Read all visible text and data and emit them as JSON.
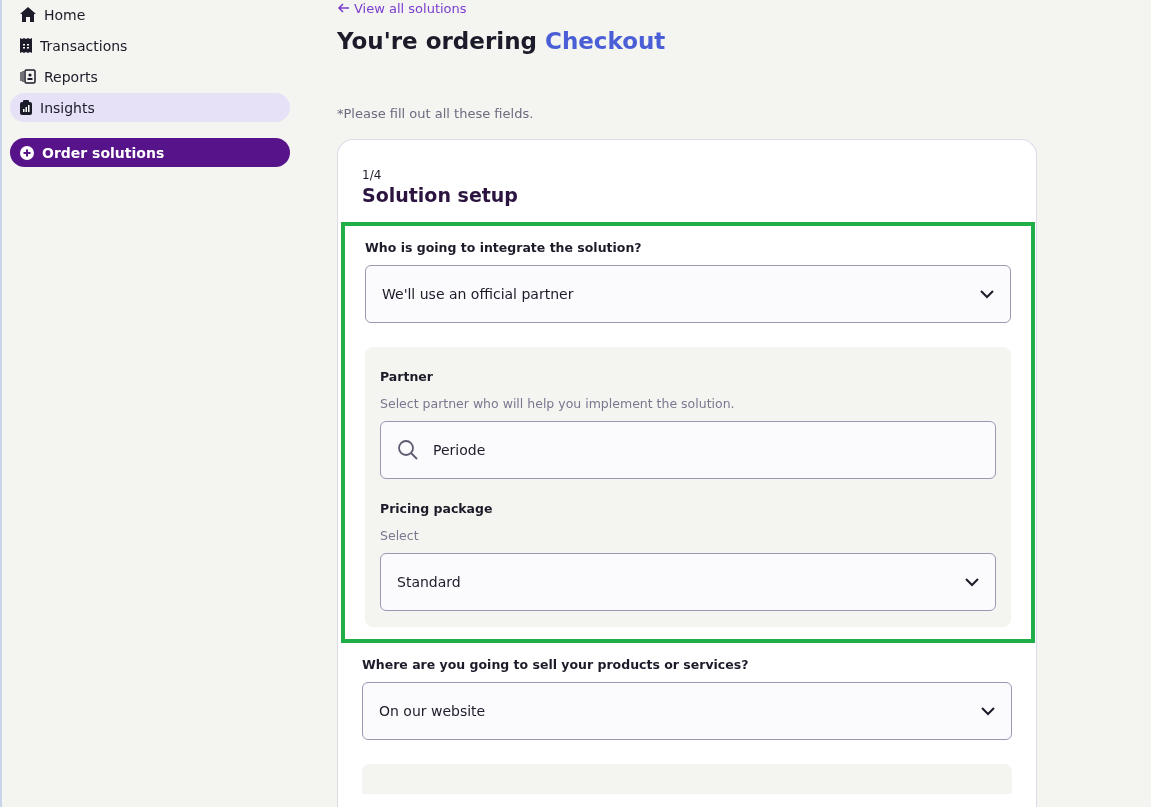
{
  "sidebar": {
    "items": [
      {
        "label": "Home",
        "selected": false
      },
      {
        "label": "Transactions",
        "selected": false
      },
      {
        "label": "Reports",
        "selected": false
      },
      {
        "label": "Insights",
        "selected": true
      }
    ],
    "action_button": {
      "label": "Order solutions"
    }
  },
  "back_link": "View all solutions",
  "title": {
    "text": "You're ordering",
    "product": "Checkout"
  },
  "note": "*Please fill out all these fields.",
  "card": {
    "step": "1/4",
    "heading": "Solution setup",
    "highlighted": true,
    "integrator": {
      "label": "Who is going to integrate the solution?",
      "value": "We'll use an official partner"
    },
    "partner_panel": {
      "partner_label": "Partner",
      "partner_hint": "Select partner who will help you implement the solution.",
      "partner_value": "Periode",
      "package_label": "Pricing package",
      "package_hint": "Select",
      "package_value": "Standard"
    },
    "sales_channel": {
      "label": "Where are you going to sell your products or services?",
      "value": "On our website"
    }
  }
}
